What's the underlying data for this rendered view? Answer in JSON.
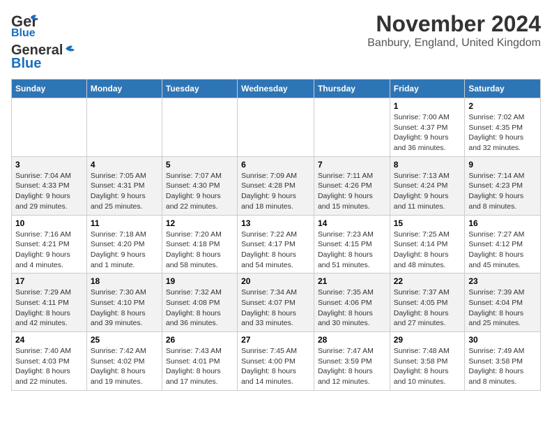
{
  "app": {
    "logo_line1": "General",
    "logo_line2": "Blue",
    "title": "November 2024",
    "subtitle": "Banbury, England, United Kingdom"
  },
  "calendar": {
    "headers": [
      "Sunday",
      "Monday",
      "Tuesday",
      "Wednesday",
      "Thursday",
      "Friday",
      "Saturday"
    ],
    "weeks": [
      [
        {
          "day": "",
          "info": ""
        },
        {
          "day": "",
          "info": ""
        },
        {
          "day": "",
          "info": ""
        },
        {
          "day": "",
          "info": ""
        },
        {
          "day": "",
          "info": ""
        },
        {
          "day": "1",
          "info": "Sunrise: 7:00 AM\nSunset: 4:37 PM\nDaylight: 9 hours and 36 minutes."
        },
        {
          "day": "2",
          "info": "Sunrise: 7:02 AM\nSunset: 4:35 PM\nDaylight: 9 hours and 32 minutes."
        }
      ],
      [
        {
          "day": "3",
          "info": "Sunrise: 7:04 AM\nSunset: 4:33 PM\nDaylight: 9 hours and 29 minutes."
        },
        {
          "day": "4",
          "info": "Sunrise: 7:05 AM\nSunset: 4:31 PM\nDaylight: 9 hours and 25 minutes."
        },
        {
          "day": "5",
          "info": "Sunrise: 7:07 AM\nSunset: 4:30 PM\nDaylight: 9 hours and 22 minutes."
        },
        {
          "day": "6",
          "info": "Sunrise: 7:09 AM\nSunset: 4:28 PM\nDaylight: 9 hours and 18 minutes."
        },
        {
          "day": "7",
          "info": "Sunrise: 7:11 AM\nSunset: 4:26 PM\nDaylight: 9 hours and 15 minutes."
        },
        {
          "day": "8",
          "info": "Sunrise: 7:13 AM\nSunset: 4:24 PM\nDaylight: 9 hours and 11 minutes."
        },
        {
          "day": "9",
          "info": "Sunrise: 7:14 AM\nSunset: 4:23 PM\nDaylight: 9 hours and 8 minutes."
        }
      ],
      [
        {
          "day": "10",
          "info": "Sunrise: 7:16 AM\nSunset: 4:21 PM\nDaylight: 9 hours and 4 minutes."
        },
        {
          "day": "11",
          "info": "Sunrise: 7:18 AM\nSunset: 4:20 PM\nDaylight: 9 hours and 1 minute."
        },
        {
          "day": "12",
          "info": "Sunrise: 7:20 AM\nSunset: 4:18 PM\nDaylight: 8 hours and 58 minutes."
        },
        {
          "day": "13",
          "info": "Sunrise: 7:22 AM\nSunset: 4:17 PM\nDaylight: 8 hours and 54 minutes."
        },
        {
          "day": "14",
          "info": "Sunrise: 7:23 AM\nSunset: 4:15 PM\nDaylight: 8 hours and 51 minutes."
        },
        {
          "day": "15",
          "info": "Sunrise: 7:25 AM\nSunset: 4:14 PM\nDaylight: 8 hours and 48 minutes."
        },
        {
          "day": "16",
          "info": "Sunrise: 7:27 AM\nSunset: 4:12 PM\nDaylight: 8 hours and 45 minutes."
        }
      ],
      [
        {
          "day": "17",
          "info": "Sunrise: 7:29 AM\nSunset: 4:11 PM\nDaylight: 8 hours and 42 minutes."
        },
        {
          "day": "18",
          "info": "Sunrise: 7:30 AM\nSunset: 4:10 PM\nDaylight: 8 hours and 39 minutes."
        },
        {
          "day": "19",
          "info": "Sunrise: 7:32 AM\nSunset: 4:08 PM\nDaylight: 8 hours and 36 minutes."
        },
        {
          "day": "20",
          "info": "Sunrise: 7:34 AM\nSunset: 4:07 PM\nDaylight: 8 hours and 33 minutes."
        },
        {
          "day": "21",
          "info": "Sunrise: 7:35 AM\nSunset: 4:06 PM\nDaylight: 8 hours and 30 minutes."
        },
        {
          "day": "22",
          "info": "Sunrise: 7:37 AM\nSunset: 4:05 PM\nDaylight: 8 hours and 27 minutes."
        },
        {
          "day": "23",
          "info": "Sunrise: 7:39 AM\nSunset: 4:04 PM\nDaylight: 8 hours and 25 minutes."
        }
      ],
      [
        {
          "day": "24",
          "info": "Sunrise: 7:40 AM\nSunset: 4:03 PM\nDaylight: 8 hours and 22 minutes."
        },
        {
          "day": "25",
          "info": "Sunrise: 7:42 AM\nSunset: 4:02 PM\nDaylight: 8 hours and 19 minutes."
        },
        {
          "day": "26",
          "info": "Sunrise: 7:43 AM\nSunset: 4:01 PM\nDaylight: 8 hours and 17 minutes."
        },
        {
          "day": "27",
          "info": "Sunrise: 7:45 AM\nSunset: 4:00 PM\nDaylight: 8 hours and 14 minutes."
        },
        {
          "day": "28",
          "info": "Sunrise: 7:47 AM\nSunset: 3:59 PM\nDaylight: 8 hours and 12 minutes."
        },
        {
          "day": "29",
          "info": "Sunrise: 7:48 AM\nSunset: 3:58 PM\nDaylight: 8 hours and 10 minutes."
        },
        {
          "day": "30",
          "info": "Sunrise: 7:49 AM\nSunset: 3:58 PM\nDaylight: 8 hours and 8 minutes."
        }
      ]
    ]
  }
}
